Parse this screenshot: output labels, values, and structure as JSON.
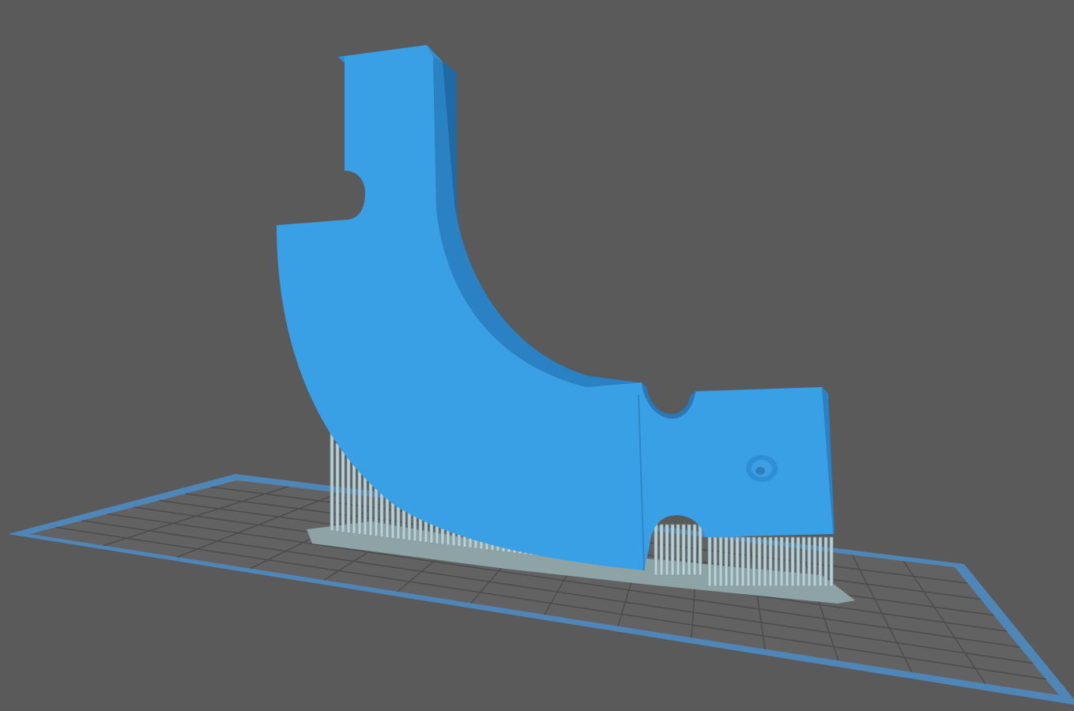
{
  "viewport": {
    "background_color": "#5a5a5a"
  },
  "build_plate": {
    "border_color": "#4f86b8",
    "surface_color": "#626262",
    "grid_color": "#4c4c4c",
    "grid_columns": 14,
    "grid_rows": 8
  },
  "model": {
    "face_color": "#3aa0e6",
    "side_color": "#2a82c4",
    "dark_side_color": "#1f6aa3",
    "support_color": "#b9d0d4",
    "brim_color": "#8ea3a6",
    "shadow_color": "#4a4a4a"
  },
  "icons": {
    "screw_hole": "countersunk-hole-icon"
  }
}
